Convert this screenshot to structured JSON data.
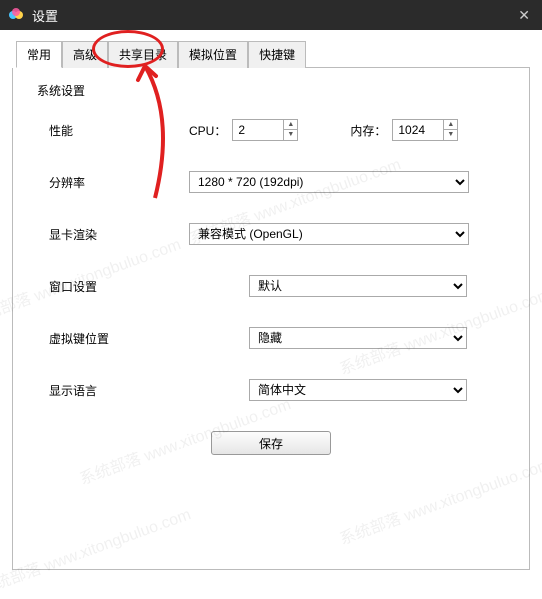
{
  "titlebar": {
    "title": "设置"
  },
  "tabs": [
    "常用",
    "高级",
    "共享目录",
    "模拟位置",
    "快捷键"
  ],
  "activeTab": 0,
  "section_title": "系统设置",
  "rows": {
    "perf": {
      "label": "性能",
      "cpu_label": "CPU：",
      "cpu_value": "2",
      "mem_label": "内存：",
      "mem_value": "1024"
    },
    "res": {
      "label": "分辨率",
      "value": "1280 * 720 (192dpi)"
    },
    "gpu": {
      "label": "显卡渲染",
      "value": "兼容模式 (OpenGL)"
    },
    "win": {
      "label": "窗口设置",
      "value": "默认"
    },
    "vkey": {
      "label": "虚拟键位置",
      "value": "隐藏"
    },
    "lang": {
      "label": "显示语言",
      "value": "简体中文"
    }
  },
  "save_label": "保存",
  "watermark": "系统部落 www.xitongbuluo.com"
}
